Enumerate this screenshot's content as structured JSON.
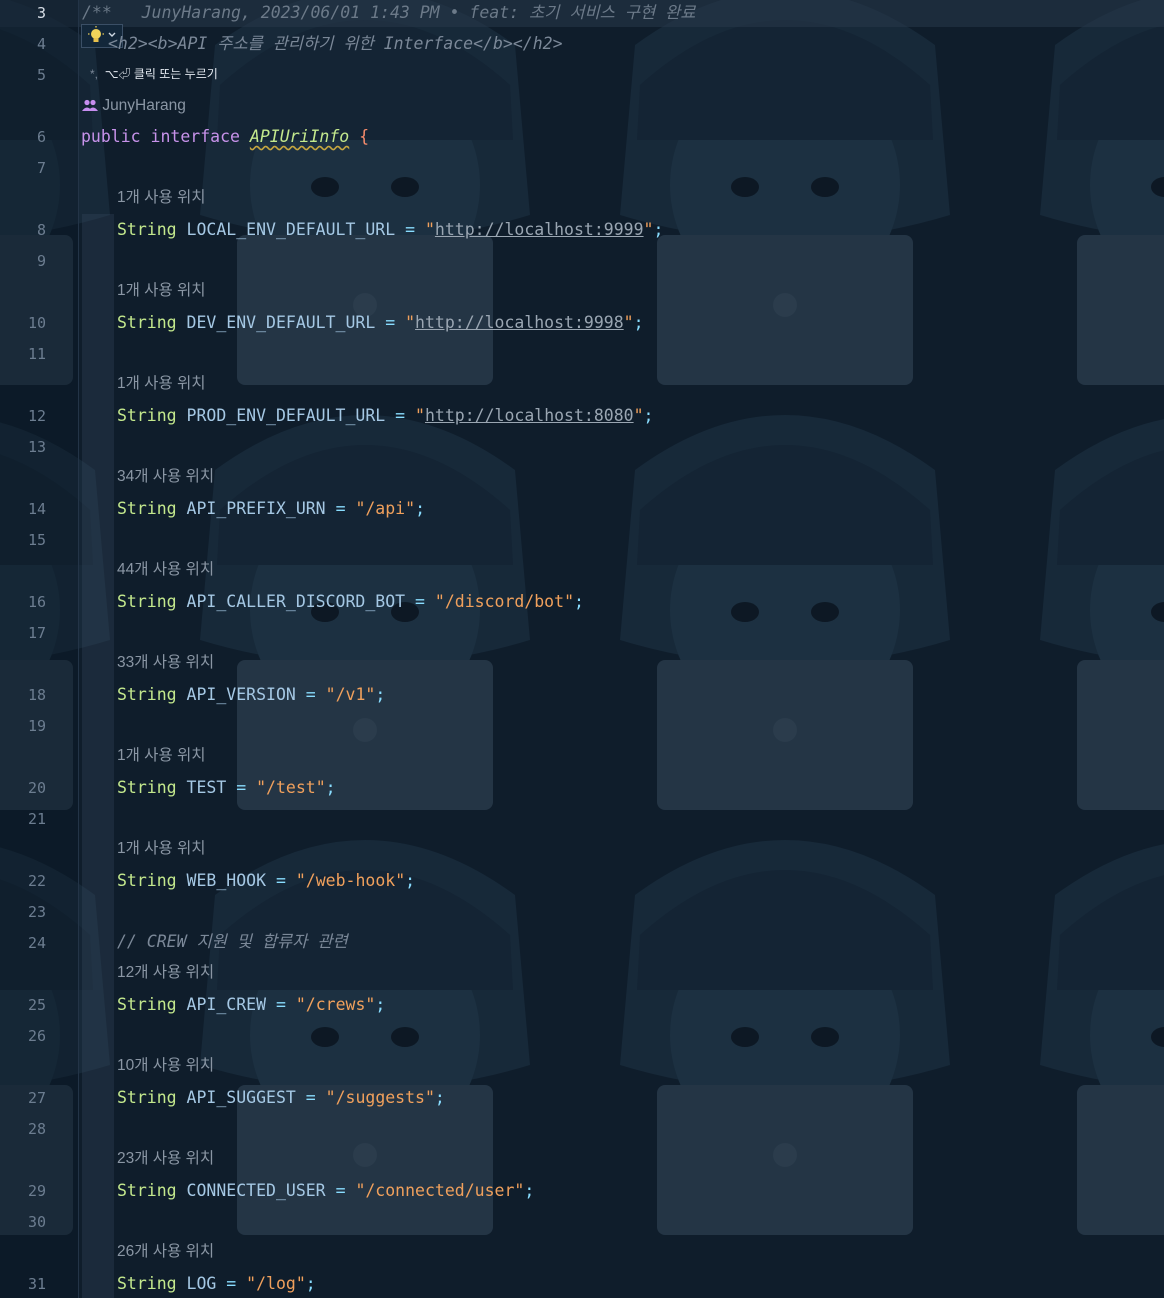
{
  "editor": {
    "current_line": "3",
    "blame_line": "/**   JunyHarang, 2023/06/01 1:43 PM • feat: 초기 서비스 구현 완료",
    "doc_line": "<h2><b>API 주소를 관리하기 위한 Interface</b></h2>",
    "doc_star": "*,",
    "quick_fix_hint": "⌥⏎ 클릭 또는 누르기",
    "author": "JunyHarang",
    "interface_decl": {
      "keyword1": "public",
      "keyword2": "interface",
      "name": "APIUriInfo",
      "brace": "{"
    },
    "line_numbers": [
      "3",
      "4",
      "5",
      "6",
      "7",
      "8",
      "9",
      "10",
      "11",
      "12",
      "13",
      "14",
      "15",
      "16",
      "17",
      "18",
      "19",
      "20",
      "21",
      "22",
      "23",
      "24",
      "25",
      "26",
      "27",
      "28",
      "29",
      "30",
      "31"
    ],
    "fields": [
      {
        "usage": "1개 사용 위치",
        "type": "String",
        "name": "LOCAL_ENV_DEFAULT_URL",
        "value": "http://localhost:9999",
        "is_url": true
      },
      {
        "usage": "1개 사용 위치",
        "type": "String",
        "name": "DEV_ENV_DEFAULT_URL",
        "value": "http://localhost:9998",
        "is_url": true
      },
      {
        "usage": "1개 사용 위치",
        "type": "String",
        "name": "PROD_ENV_DEFAULT_URL",
        "value": "http://localhost:8080",
        "is_url": true
      },
      {
        "usage": "34개 사용 위치",
        "type": "String",
        "name": "API_PREFIX_URN",
        "value": "/api",
        "is_url": false
      },
      {
        "usage": "44개 사용 위치",
        "type": "String",
        "name": "API_CALLER_DISCORD_BOT",
        "value": "/discord/bot",
        "is_url": false
      },
      {
        "usage": "33개 사용 위치",
        "type": "String",
        "name": "API_VERSION",
        "value": "/v1",
        "is_url": false
      },
      {
        "usage": "1개 사용 위치",
        "type": "String",
        "name": "TEST",
        "value": "/test",
        "is_url": false
      },
      {
        "usage": "1개 사용 위치",
        "type": "String",
        "name": "WEB_HOOK",
        "value": "/web-hook",
        "is_url": false
      },
      {
        "usage": "12개 사용 위치",
        "type": "String",
        "name": "API_CREW",
        "value": "/crews",
        "is_url": false
      },
      {
        "usage": "10개 사용 위치",
        "type": "String",
        "name": "API_SUGGEST",
        "value": "/suggests",
        "is_url": false
      },
      {
        "usage": "23개 사용 위치",
        "type": "String",
        "name": "CONNECTED_USER",
        "value": "/connected/user",
        "is_url": false
      },
      {
        "usage": "26개 사용 위치",
        "type": "String",
        "name": "LOG",
        "value": "/log",
        "is_url": false
      }
    ],
    "crew_comment": "// CREW 지원 및 합류자 관련"
  },
  "colors": {
    "background": "#0f1d2b",
    "keyword": "#c792ea",
    "type": "#c3e88d",
    "string": "#f0a05c",
    "identifier": "#a5c8e4",
    "comment": "#7b8898"
  },
  "icons": [
    "lightbulb-icon",
    "chevron-down-icon",
    "people-icon"
  ]
}
